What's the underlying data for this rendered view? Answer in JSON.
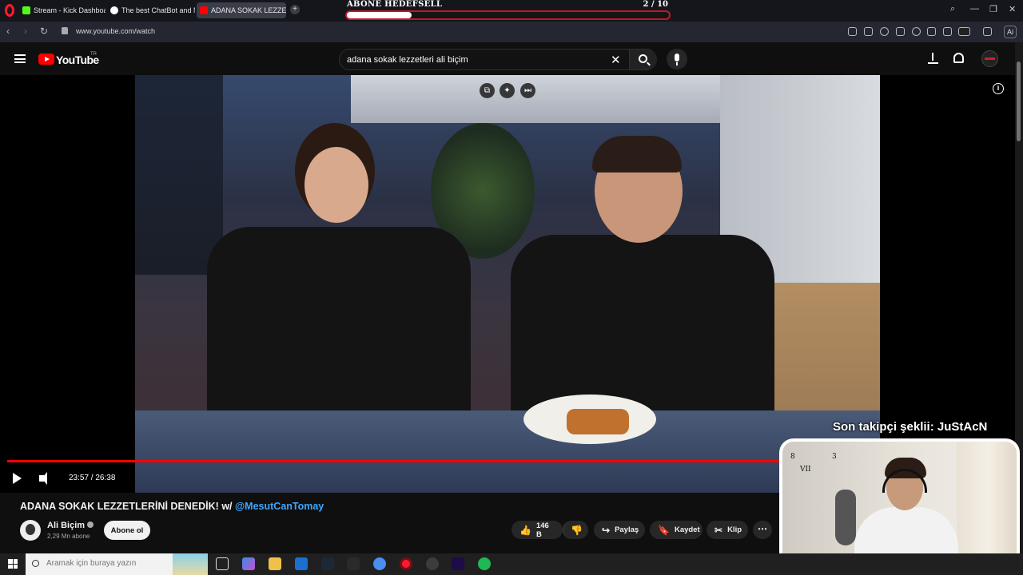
{
  "browser": {
    "tabs": [
      {
        "label": "Stream - Kick Dashboard",
        "active": false
      },
      {
        "label": "The best ChatBot and M",
        "active": false
      },
      {
        "label": "ADANA SOKAK LEZZETLE",
        "active": true
      }
    ],
    "url": "www.youtube.com/watch",
    "ai_badge": "Ai"
  },
  "goal_widget": {
    "title": "ABONE HEDEFSELL",
    "count_text": "2  / 10",
    "progress": 0.2
  },
  "youtube": {
    "wordmark": "YouTube",
    "country": "TR",
    "search_value": "adana sokak lezzetleri ali biçim"
  },
  "player": {
    "time_text": "23:57 / 26:38",
    "progress": 0.899,
    "follower_text": "Son takipçi şeklii: JuStAcN"
  },
  "webcam": {
    "clock_numerals": [
      "8",
      "VII",
      "3"
    ]
  },
  "video": {
    "title_main": "ADANA SOKAK LEZZETLERİNİ DENEDİK! w/ ",
    "title_mention": "@MesutCanTomay",
    "channel_name": "Ali Biçim",
    "subscribers": "2,29 Mn abone",
    "subscribe_label": "Abone ol",
    "like_count": "146 B",
    "share_label": "Paylaş",
    "save_label": "Kaydet",
    "clip_label": "Klip"
  },
  "taskbar": {
    "search_placeholder": "Aramak için buraya yazın"
  },
  "colors": {
    "youtube_red": "#ff0000",
    "goal_border": "#c5162b",
    "mention_link": "#3ea6ff",
    "background": "#0f0f0f"
  }
}
